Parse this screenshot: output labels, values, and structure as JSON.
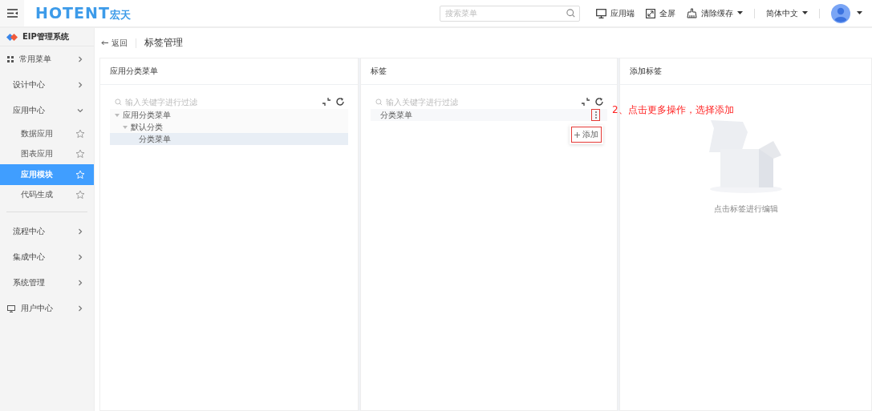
{
  "header": {
    "logo": "HOTENT",
    "logo_suffix": "宏天",
    "search": {
      "placeholder": "搜索菜单"
    },
    "actions": [
      {
        "kind": "monitor",
        "label": "应用端",
        "dropdown": false
      },
      {
        "kind": "fullscreen",
        "label": "全屏",
        "dropdown": false
      },
      {
        "kind": "clean",
        "label": "清除缓存",
        "dropdown": true
      }
    ],
    "language": "简体中文"
  },
  "sidebar": {
    "system": "EIP管理系统",
    "items": [
      {
        "kind": "shortcut",
        "label": "常用菜单",
        "expanded": false
      },
      {
        "kind": "module",
        "label": "设计中心",
        "expanded": false
      },
      {
        "kind": "module",
        "label": "应用中心",
        "expanded": true,
        "children": [
          {
            "label": "数据应用",
            "selected": false
          },
          {
            "label": "图表应用",
            "selected": false
          },
          {
            "label": "应用模块",
            "selected": true
          },
          {
            "label": "代码生成",
            "selected": false
          }
        ]
      },
      {
        "kind": "module",
        "label": "流程中心",
        "expanded": false
      },
      {
        "kind": "module",
        "label": "集成中心",
        "expanded": false
      },
      {
        "kind": "module",
        "label": "系统管理",
        "expanded": false
      },
      {
        "kind": "account",
        "label": "用户中心",
        "expanded": false
      }
    ]
  },
  "breadcrumb": {
    "back": "返回",
    "title": "标签管理"
  },
  "panels": [
    {
      "kind": "tree",
      "title": "应用分类菜单",
      "filter_placeholder": "输入关键字进行过滤",
      "nodes": [
        {
          "label": "应用分类菜单",
          "expanded": true,
          "selected": false,
          "children": [
            {
              "label": "默认分类",
              "expanded": true,
              "selected": false,
              "children": [
                {
                  "label": "分类菜单",
                  "selected": true
                }
              ]
            }
          ]
        }
      ]
    },
    {
      "kind": "list",
      "title": "标签",
      "filter_placeholder": "输入关键字进行过滤",
      "rows": [
        {
          "label": "分类菜单",
          "menu_open": true
        }
      ],
      "menu": [
        {
          "label": "添加"
        }
      ],
      "annotation": "2、点击更多操作，选择添加"
    },
    {
      "kind": "empty",
      "title": "添加标签",
      "empty_text": "点击标签进行编辑"
    }
  ]
}
